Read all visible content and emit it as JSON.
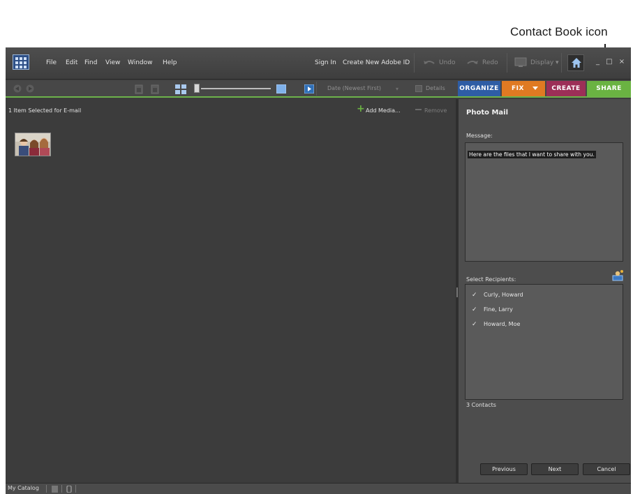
{
  "callout": {
    "text": "Contact Book icon"
  },
  "menubar": {
    "items": [
      "File",
      "Edit",
      "Find",
      "View",
      "Window",
      "Help"
    ],
    "sign_in": "Sign In",
    "create_id": "Create New Adobe ID",
    "undo": "Undo",
    "redo": "Redo",
    "display": "Display ▾",
    "window_controls": "_ □ ×"
  },
  "toolbar": {
    "sort": "Date (Newest First)",
    "details": "Details",
    "tabs": {
      "organize": "ORGANIZE",
      "fix": "FIX",
      "create": "CREATE",
      "share": "SHARE"
    },
    "tab_colors": {
      "organize": "#2e5da5",
      "fix": "#e07a22",
      "create": "#9c2f57",
      "share": "#6ab342"
    }
  },
  "left_panel": {
    "selection_status": "1 Item Selected for E-mail",
    "add_media": "Add Media...",
    "remove": "Remove"
  },
  "right_panel": {
    "title": "Photo Mail",
    "message_label": "Message:",
    "message_text": "Here are the files that I want to share with you.",
    "recipients_label": "Select Recipients:",
    "recipients": [
      {
        "name": "Curly, Howard",
        "checked": true
      },
      {
        "name": "Fine, Larry",
        "checked": true
      },
      {
        "name": "Howard, Moe",
        "checked": true
      }
    ],
    "contact_count": "3 Contacts",
    "buttons": {
      "previous": "Previous",
      "next": "Next",
      "cancel": "Cancel"
    }
  },
  "statusbar": {
    "catalog": "My Catalog"
  }
}
